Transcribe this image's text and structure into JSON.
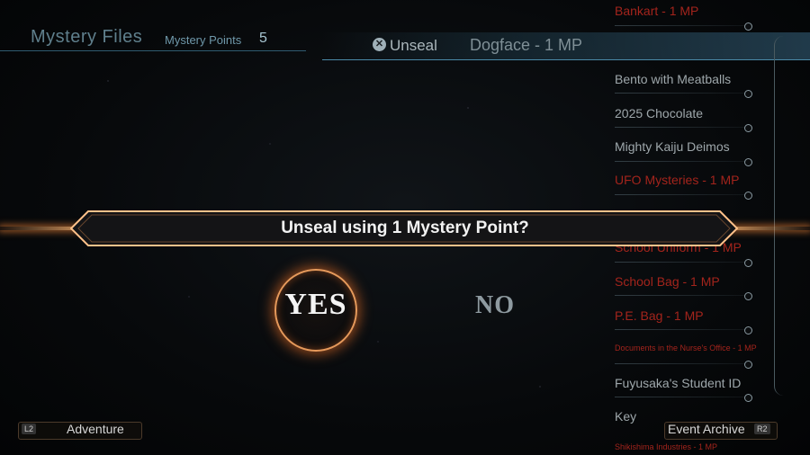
{
  "header": {
    "title": "Mystery Files",
    "points_label": "Mystery Points",
    "points_value": "5"
  },
  "selection": {
    "action_icon": "x-button-icon",
    "action_label": "Unseal",
    "item_label": "Dogface - 1 MP"
  },
  "list": {
    "items": [
      {
        "label": "Bankart - 1 MP",
        "locked": true
      },
      {
        "label": "Bento with Meatballs",
        "locked": false
      },
      {
        "label": "2025 Chocolate",
        "locked": false
      },
      {
        "label": "Mighty Kaiju Deimos",
        "locked": false
      },
      {
        "label": "UFO Mysteries - 1 MP",
        "locked": true
      },
      {
        "label": "School Uniform - 1 MP",
        "locked": true
      },
      {
        "label": "School Bag - 1 MP",
        "locked": true
      },
      {
        "label": "P.E. Bag - 1 MP",
        "locked": true
      },
      {
        "label": "Documents in the Nurse's Office - 1 MP",
        "locked": true
      },
      {
        "label": "Fuyusaka's Student ID",
        "locked": false
      },
      {
        "label": "Key",
        "locked": false
      },
      {
        "label": "Shikishima Industries - 1 MP",
        "locked": true
      }
    ],
    "locked_color": "#a3241c",
    "normal_color": "#9ea7ab"
  },
  "dialog": {
    "prompt": "Unseal using 1 Mystery Point?",
    "yes_label": "YES",
    "no_label": "NO",
    "accent_color": "#ffa860"
  },
  "bottom_nav": {
    "left_button": "L2",
    "left_label": "Adventure",
    "right_label": "Event Archive",
    "right_button": "R2"
  }
}
